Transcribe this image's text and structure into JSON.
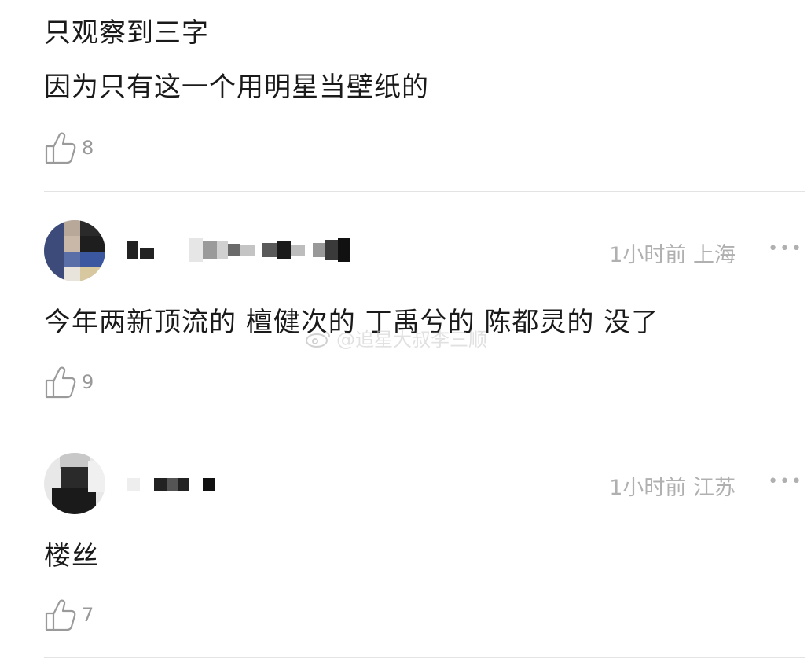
{
  "top_comment": {
    "lines": [
      "只观察到三字",
      "因为只有这一个用明星当壁纸的"
    ],
    "likes": "8"
  },
  "comments": [
    {
      "time_location": "1小时前 上海",
      "text": "今年两新顶流的 檀健次的 丁禹兮的 陈都灵的 没了",
      "likes": "9",
      "more": "•••"
    },
    {
      "time_location": "1小时前 江苏",
      "text": "楼丝",
      "likes": "7",
      "more": "•••"
    }
  ],
  "watermark": {
    "text": "@追星大叔李三顺",
    "icon": "weibo-icon"
  },
  "icons": {
    "like": "thumbs-up-icon",
    "more": "more-dots-icon"
  },
  "colors": {
    "text": "#1a1a1a",
    "meta": "#b0b0b0",
    "divider": "#e3e3e3"
  }
}
